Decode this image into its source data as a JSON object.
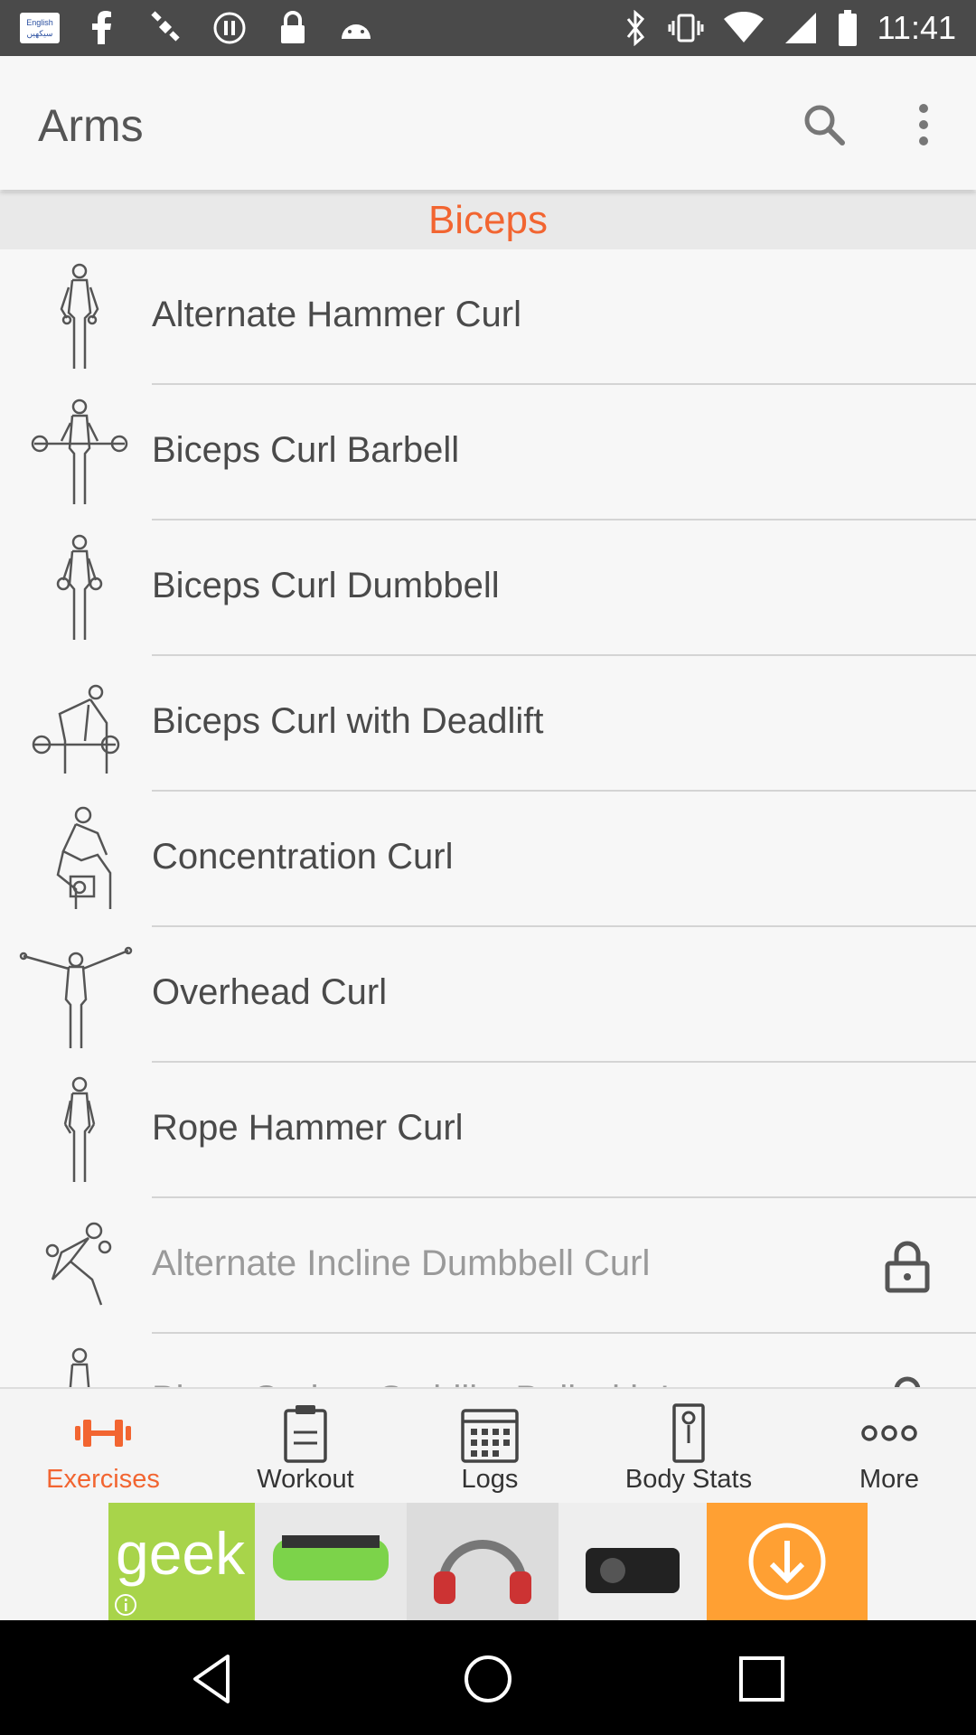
{
  "statusbar": {
    "time": "11:41",
    "left_icons": [
      "language-icon",
      "facebook-icon",
      "satellite-icon",
      "pause-icon",
      "lock-icon",
      "android-icon"
    ],
    "right_icons": [
      "bluetooth-icon",
      "vibrate-icon",
      "wifi-icon",
      "signal-icon",
      "battery-icon"
    ],
    "lang_top": "English",
    "lang_bottom": "سیکھیں"
  },
  "appbar": {
    "title": "Arms",
    "search_icon": "search-icon",
    "more_icon": "more-vert-icon"
  },
  "section": {
    "title": "Biceps"
  },
  "exercises": [
    {
      "name": "Alternate Hammer Curl",
      "locked": false
    },
    {
      "name": "Biceps Curl Barbell",
      "locked": false
    },
    {
      "name": "Biceps Curl Dumbbell",
      "locked": false
    },
    {
      "name": "Biceps Curl with Deadlift",
      "locked": false
    },
    {
      "name": "Concentration Curl",
      "locked": false
    },
    {
      "name": "Overhead Curl",
      "locked": false
    },
    {
      "name": "Rope Hammer Curl",
      "locked": false
    },
    {
      "name": "Alternate Incline Dumbbell Curl",
      "locked": true
    },
    {
      "name": "Bicep Curl on Stability Ball with Leg",
      "locked": true
    }
  ],
  "tabs": [
    {
      "label": "Exercises",
      "icon": "dumbbell-icon",
      "active": true
    },
    {
      "label": "Workout",
      "icon": "clipboard-icon",
      "active": false
    },
    {
      "label": "Logs",
      "icon": "calendar-icon",
      "active": false
    },
    {
      "label": "Body Stats",
      "icon": "scale-icon",
      "active": false
    },
    {
      "label": "More",
      "icon": "more-horiz-icon",
      "active": false
    }
  ],
  "ad": {
    "brand_text": "geek",
    "download_icon": "download-icon",
    "info_icon": "info-icon"
  },
  "colors": {
    "accent": "#f26531",
    "statusbar": "#4a4a4a",
    "ad_green": "#a8d44a",
    "ad_orange": "#ffa033"
  },
  "navbar": {
    "icons": [
      "back-icon",
      "home-icon",
      "recents-icon"
    ]
  }
}
